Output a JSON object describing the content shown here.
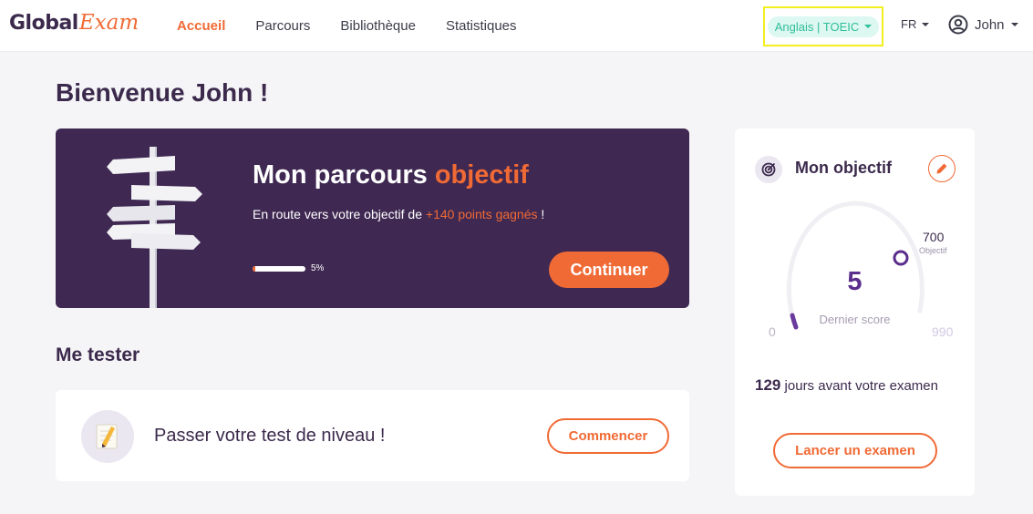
{
  "brand": {
    "part1": "Global",
    "part2": "Exam"
  },
  "nav": {
    "items": [
      {
        "label": "Accueil",
        "active": true
      },
      {
        "label": "Parcours",
        "active": false
      },
      {
        "label": "Bibliothèque",
        "active": false
      },
      {
        "label": "Statistiques",
        "active": false
      }
    ]
  },
  "header": {
    "language_selector": "Anglais | TOEIC",
    "locale": "FR",
    "user_name": "John"
  },
  "main": {
    "welcome": "Bienvenue John !",
    "hero": {
      "title_start": "Mon parcours",
      "title_accent": "objectif",
      "subtitle_start": "En route vers votre objectif de",
      "subtitle_accent": "+140 points gagnés",
      "subtitle_end": "!",
      "progress_percent": 5,
      "progress_label": "5%",
      "button_label": "Continuer"
    },
    "test_section": {
      "title": "Me tester",
      "card_label": "Passer votre test de niveau !",
      "button_label": "Commencer"
    }
  },
  "objective": {
    "title": "Mon objectif",
    "target_value": "700",
    "target_label": "Objectif",
    "score_value": "5",
    "score_label": "Dernier score",
    "scale_min": "0",
    "scale_max": "990",
    "days_count": "129",
    "days_text": "jours avant votre examen",
    "button_label": "Lancer un examen"
  },
  "colors": {
    "accent": "#f06a35",
    "hero_bg": "#3f2852",
    "brand_dark": "#3c2a4d",
    "language_pill_text": "#2fbf9a",
    "language_pill_bg": "#ddf7f1",
    "score": "#5b2d8c"
  },
  "icons": {
    "user": "user-circle-icon",
    "caret": "chevron-down-icon",
    "objective": "target-icon",
    "edit": "pencil-icon",
    "test": "notepad-pencil-icon",
    "hero": "signpost-illustration"
  }
}
